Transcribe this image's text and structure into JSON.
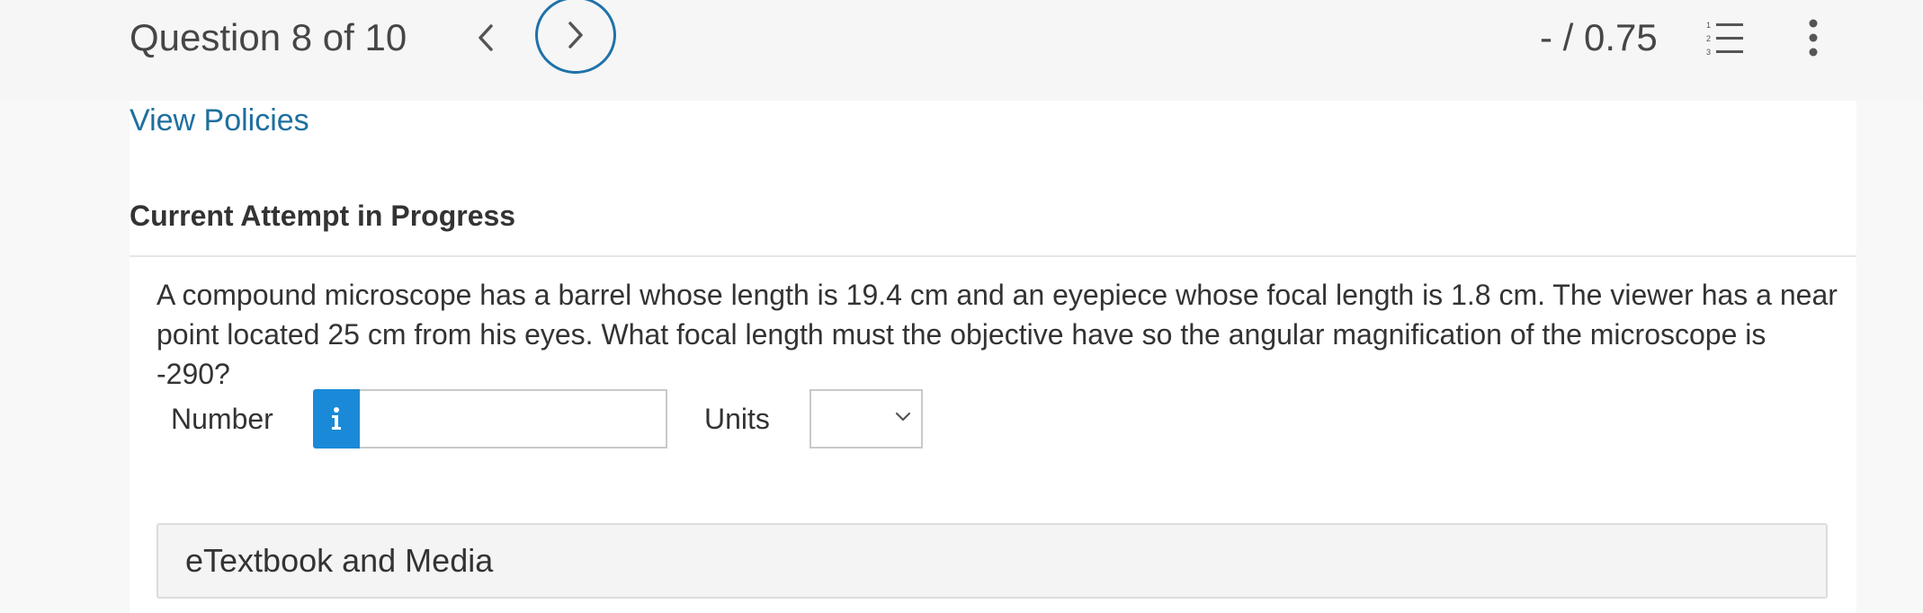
{
  "header": {
    "question_label": "Question 8 of 10",
    "score": "- / 0.75",
    "prev_icon": "chevron-left-icon",
    "next_icon": "chevron-right-icon",
    "list_icon": "numbered-list-icon",
    "menu_icon": "more-vertical-icon",
    "accent_color": "#1f72a8"
  },
  "policies": {
    "link_label": "View Policies",
    "link_color": "#1e6f9f"
  },
  "attempt": {
    "heading": "Current Attempt in Progress"
  },
  "question": {
    "text": "A compound microscope has a barrel whose length is 19.4 cm and an eyepiece whose focal length is 1.8 cm. The viewer has a near point located 25 cm from his eyes. What focal length must the objective have so the angular magnification of the microscope is -290?"
  },
  "answer": {
    "number_label": "Number",
    "number_value": "",
    "info_icon": "info-icon",
    "info_color": "#1a8ad8",
    "units_label": "Units",
    "units_selected": ""
  },
  "resources": {
    "etextbook_label": "eTextbook and Media"
  }
}
